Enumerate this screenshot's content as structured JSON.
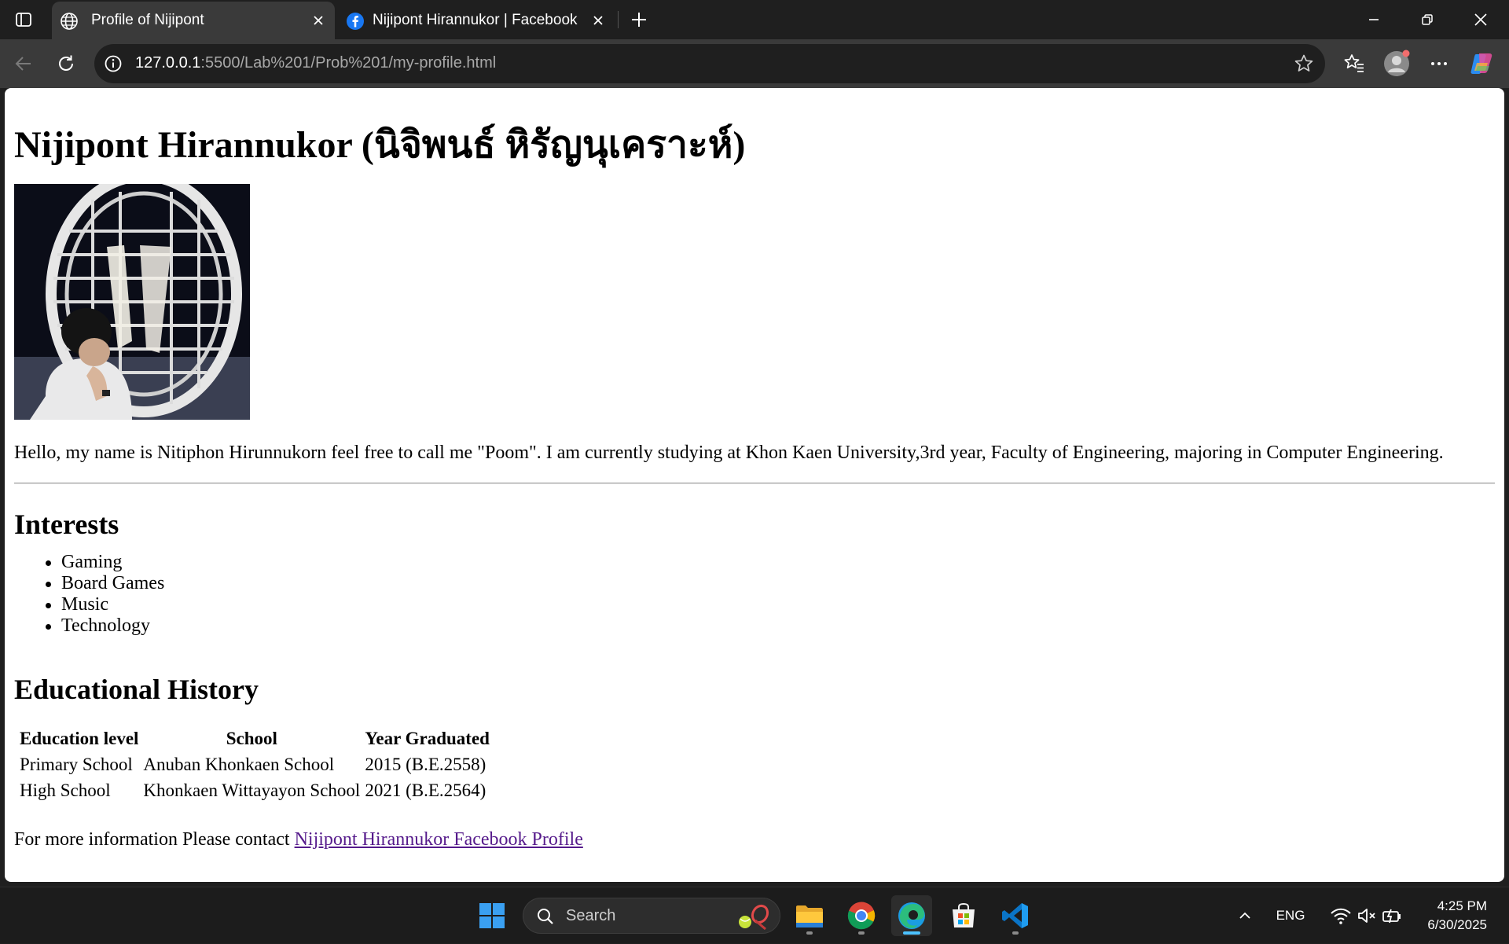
{
  "browser": {
    "tabs": [
      {
        "title": "Profile of Nijipont",
        "icon": "globe-icon",
        "active": true
      },
      {
        "title": "Nijipont Hirannukor | Facebook",
        "icon": "facebook-icon",
        "active": false
      }
    ],
    "address": {
      "host": "127.0.0.1",
      "path": ":5500/Lab%201/Prob%201/my-profile.html"
    }
  },
  "page": {
    "heading": "Nijipont Hirannukor (นิจิพนธ์ หิรัญนุเคราะห์)",
    "intro": "Hello, my name is Nitiphon Hirunnukorn feel free to call me \"Poom\". I am currently studying at Khon Kaen University,3rd year, Faculty of Engineering, majoring in Computer Engineering.",
    "interests_heading": "Interests",
    "interests": [
      "Gaming",
      "Board Games",
      "Music",
      "Technology"
    ],
    "education_heading": "Educational History",
    "education_table": {
      "headers": [
        "Education level",
        "School",
        "Year Graduated"
      ],
      "rows": [
        [
          "Primary School",
          "Anuban Khonkaen School",
          "2015 (B.E.2558)"
        ],
        [
          "High School",
          "Khonkaen Wittayayon School",
          "2021 (B.E.2564)"
        ]
      ]
    },
    "contact_text": "For more information Please contact ",
    "contact_link": "Nijipont Hirannukor Facebook Profile"
  },
  "taskbar": {
    "search_placeholder": "Search",
    "language": "ENG",
    "time": "4:25 PM",
    "date": "6/30/2025",
    "apps": [
      "file-explorer-icon",
      "chrome-icon",
      "edge-icon",
      "store-icon",
      "vscode-icon"
    ]
  },
  "colors": {
    "visited_link": "#551a8b",
    "accent": "#4cc2ff"
  }
}
